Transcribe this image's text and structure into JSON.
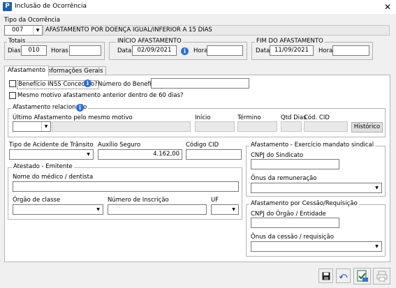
{
  "window": {
    "title": "Inclusão de Ocorrência",
    "app_icon": "P"
  },
  "tipo": {
    "label": "Tipo da Ocorrência",
    "code": "007",
    "description": "AFASTAMENTO POR DOENÇA IGUAL/INFERIOR A 15 DIAS"
  },
  "totais": {
    "label": "Totais",
    "dias_label": "Dias",
    "dias_value": "010",
    "horas_label": "Horas",
    "horas_value": ""
  },
  "inicio": {
    "label": "INÍCIO AFASTAMENTO",
    "data_label": "Data",
    "data_value": "02/09/2021",
    "hora_label": "Hora",
    "hora_value": ""
  },
  "fim": {
    "label": "FIM DO AFASTAMENTO",
    "data_label": "Data",
    "data_value": "11/09/2021",
    "hora_label": "Hora",
    "hora_value": ""
  },
  "tabs": [
    {
      "label": "Afastamento"
    },
    {
      "label": "Informações Gerais"
    }
  ],
  "afastamento": {
    "beneficio_inss": "Benefício INSS Concedido?",
    "numero_beneficio_label": "Número do Benefício",
    "mesmo_motivo": "Mesmo motivo afastamento anterior dentro de 60 dias?",
    "relacionado": {
      "label": "Afastamento relacionado",
      "ultimo_label": "Último Afastamento pelo mesmo motivo",
      "inicio_label": "Início",
      "termino_label": "Término",
      "qtd_dias_label": "Qtd Dias",
      "cod_cid_label": "Cód. CID",
      "historico_button": "Histórico"
    },
    "tipo_acidente_label": "Tipo de Acidente de Trânsito",
    "auxilio_label": "Auxílio Seguro",
    "auxilio_value": "4.162,00",
    "codigo_cid_label": "Código CID",
    "atestado": {
      "label": "Atestado - Emitente",
      "nome_label": "Nome do médico / dentista",
      "orgao_label": "Órgão de classe",
      "numero_inscricao_label": "Número de Inscrição",
      "uf_label": "UF"
    },
    "sindical": {
      "label": "Afastamento - Exercício mandato sindical",
      "cnpj_label": "CNPJ do Sindicato",
      "onus_label": "Ônus da remuneração"
    },
    "cessao": {
      "label": "Afastamento por Cessão/Requisição",
      "cnpj_label": "CNPJ do Órgão / Entidade",
      "onus_label": "Ônus da cessão / requisição"
    }
  },
  "toolbar": {
    "save_icon": "save-icon",
    "undo_icon": "undo-icon",
    "calc_icon": "document-check-icon",
    "print_icon": "printer-disabled-icon"
  },
  "colors": {
    "info_icon": "#2f6fd6",
    "app_icon": "#1f5fa8"
  }
}
